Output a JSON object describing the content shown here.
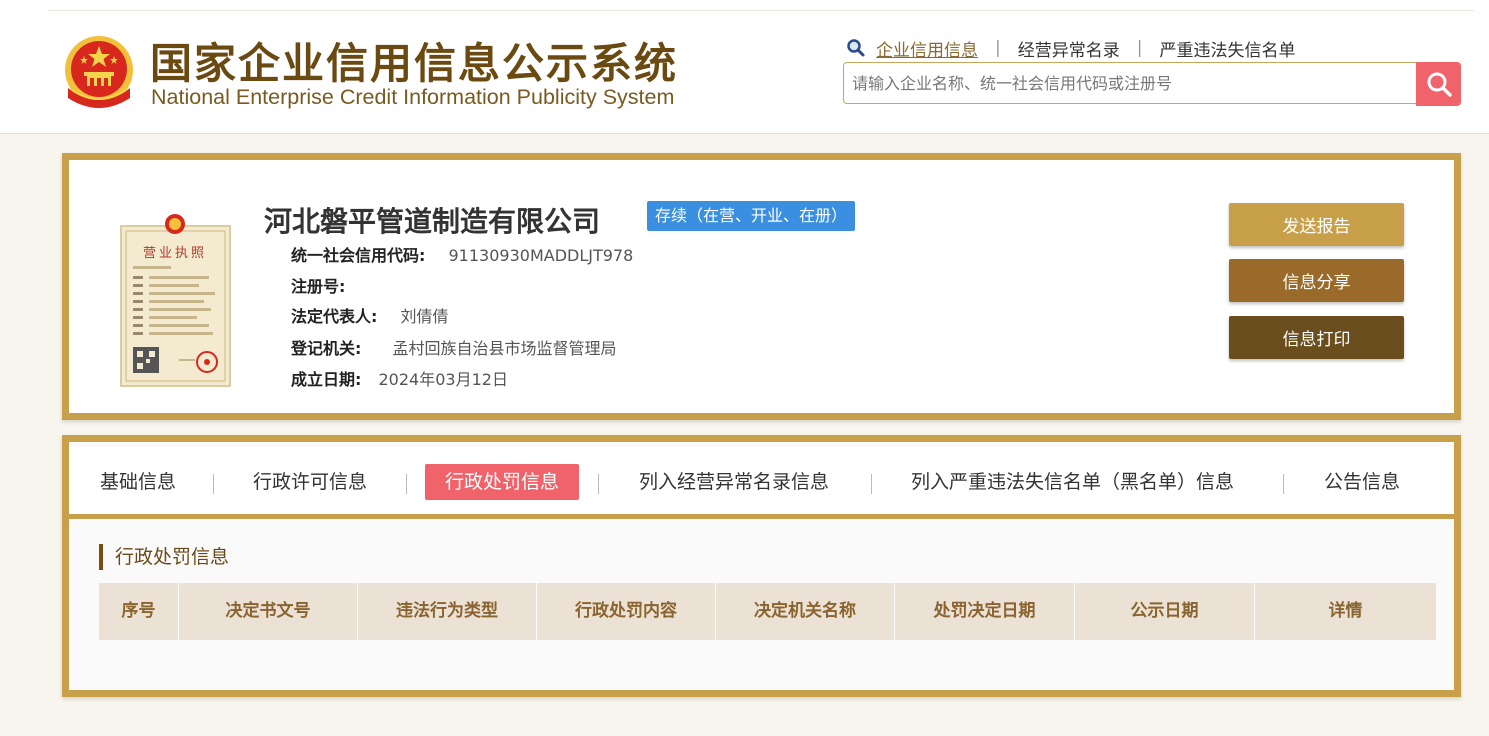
{
  "header": {
    "title_cn": "国家企业信用信息公示系统",
    "title_en": "National Enterprise Credit Information Publicity System",
    "links": [
      "企业信用信息",
      "经营异常名录",
      "严重违法失信名单"
    ],
    "search_placeholder": "请输入企业名称、统一社会信用代码或注册号"
  },
  "company": {
    "name": "河北磐平管道制造有限公司",
    "status": "存续（在营、开业、在册）",
    "fields": [
      {
        "label": "统一社会信用代码:",
        "value": "91130930MADDLJT978"
      },
      {
        "label": "注册号:",
        "value": ""
      },
      {
        "label": "法定代表人:",
        "value": "刘倩倩"
      },
      {
        "label": "登记机关:",
        "value": "孟村回族自治县市场监督管理局"
      },
      {
        "label": "成立日期:",
        "value": "2024年03月12日"
      }
    ],
    "license_title": "营业执照"
  },
  "actions": {
    "send_report": "发送报告",
    "share": "信息分享",
    "print": "信息打印"
  },
  "tabs": [
    "基础信息",
    "行政许可信息",
    "行政处罚信息",
    "列入经营异常名录信息",
    "列入严重违法失信名单（黑名单）信息",
    "公告信息"
  ],
  "active_tab": "行政处罚信息",
  "section": {
    "title": "行政处罚信息",
    "columns": [
      "序号",
      "决定书文号",
      "违法行为类型",
      "行政处罚内容",
      "决定机关名称",
      "处罚决定日期",
      "公示日期",
      "详情"
    ]
  },
  "colors": {
    "gold_border": "#c9a04a",
    "accent_red": "#f0636a",
    "status_blue": "#3b8fe0",
    "btn_send": "#c9a04a",
    "btn_share": "#9a6a2a",
    "btn_print": "#6a4e1e"
  }
}
